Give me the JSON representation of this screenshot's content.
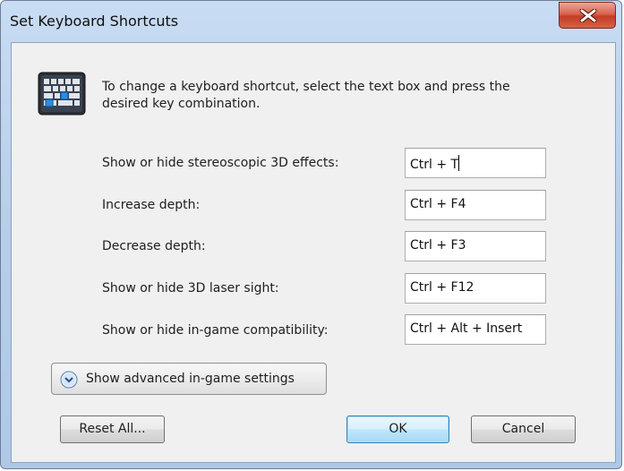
{
  "window": {
    "title": "Set Keyboard Shortcuts"
  },
  "icons": {
    "close": "close-icon",
    "keyboard": "keyboard-icon",
    "expand": "chevron-down-circle-icon"
  },
  "intro": {
    "text": "To change a keyboard shortcut, select the text box and press the desired key combination."
  },
  "shortcuts": [
    {
      "label": "Show or hide stereoscopic 3D effects:",
      "value": "Ctrl + T"
    },
    {
      "label": "Increase depth:",
      "value": "Ctrl + F4"
    },
    {
      "label": "Decrease depth:",
      "value": "Ctrl + F3"
    },
    {
      "label": "Show or hide 3D laser sight:",
      "value": "Ctrl + F12"
    },
    {
      "label": "Show or hide in-game compatibility:",
      "value": "Ctrl + Alt + Insert"
    }
  ],
  "buttons": {
    "advanced": "Show advanced in-game settings",
    "reset_all": "Reset All...",
    "ok": "OK",
    "cancel": "Cancel"
  },
  "colors": {
    "close_button": "#c43c24",
    "default_button_border": "#3c7fb1",
    "window_frame": "#b8cfea"
  }
}
